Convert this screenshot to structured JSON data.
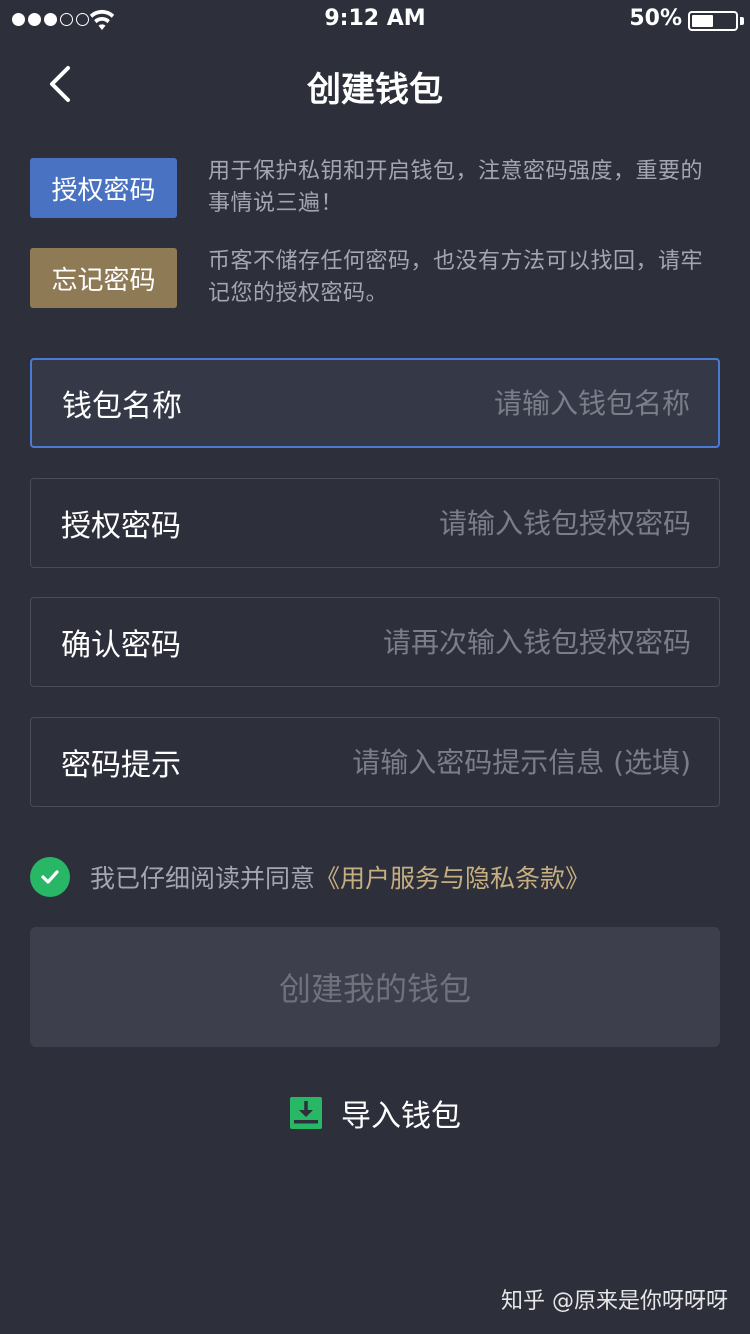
{
  "status_bar": {
    "time": "9:12 AM",
    "battery_percent": "50%",
    "battery_level": 0.5,
    "signal_bars_filled": 3,
    "signal_bars_total": 5
  },
  "nav": {
    "title": "创建钱包",
    "back_icon": "chevron-left-icon"
  },
  "info": [
    {
      "tag": "授权密码",
      "text": "用于保护私钥和开启钱包，注意密码强度，重要的事情说三遍！"
    },
    {
      "tag": "忘记密码",
      "text": "币客不储存任何密码，也没有方法可以找回，请牢记您的授权密码。"
    }
  ],
  "fields": [
    {
      "label": "钱包名称",
      "placeholder": "请输入钱包名称"
    },
    {
      "label": "授权密码",
      "placeholder": "请输入钱包授权密码"
    },
    {
      "label": "确认密码",
      "placeholder": "请再次输入钱包授权密码"
    },
    {
      "label": "密码提示",
      "placeholder": "请输入密码提示信息 (选填)"
    }
  ],
  "agreement": {
    "text": "我已仔细阅读并同意",
    "link": "《用户服务与隐私条款》",
    "checked": true
  },
  "create_button": "创建我的钱包",
  "import_label": "导入钱包",
  "watermark": "知乎 @原来是你呀呀呀",
  "colors": {
    "background": "#2d303b",
    "tag_blue": "#4a72c2",
    "tag_brown": "#8f7a56",
    "focus_border": "#4a7ad4",
    "check_green": "#27b765",
    "link_gold": "#c7ae80"
  }
}
